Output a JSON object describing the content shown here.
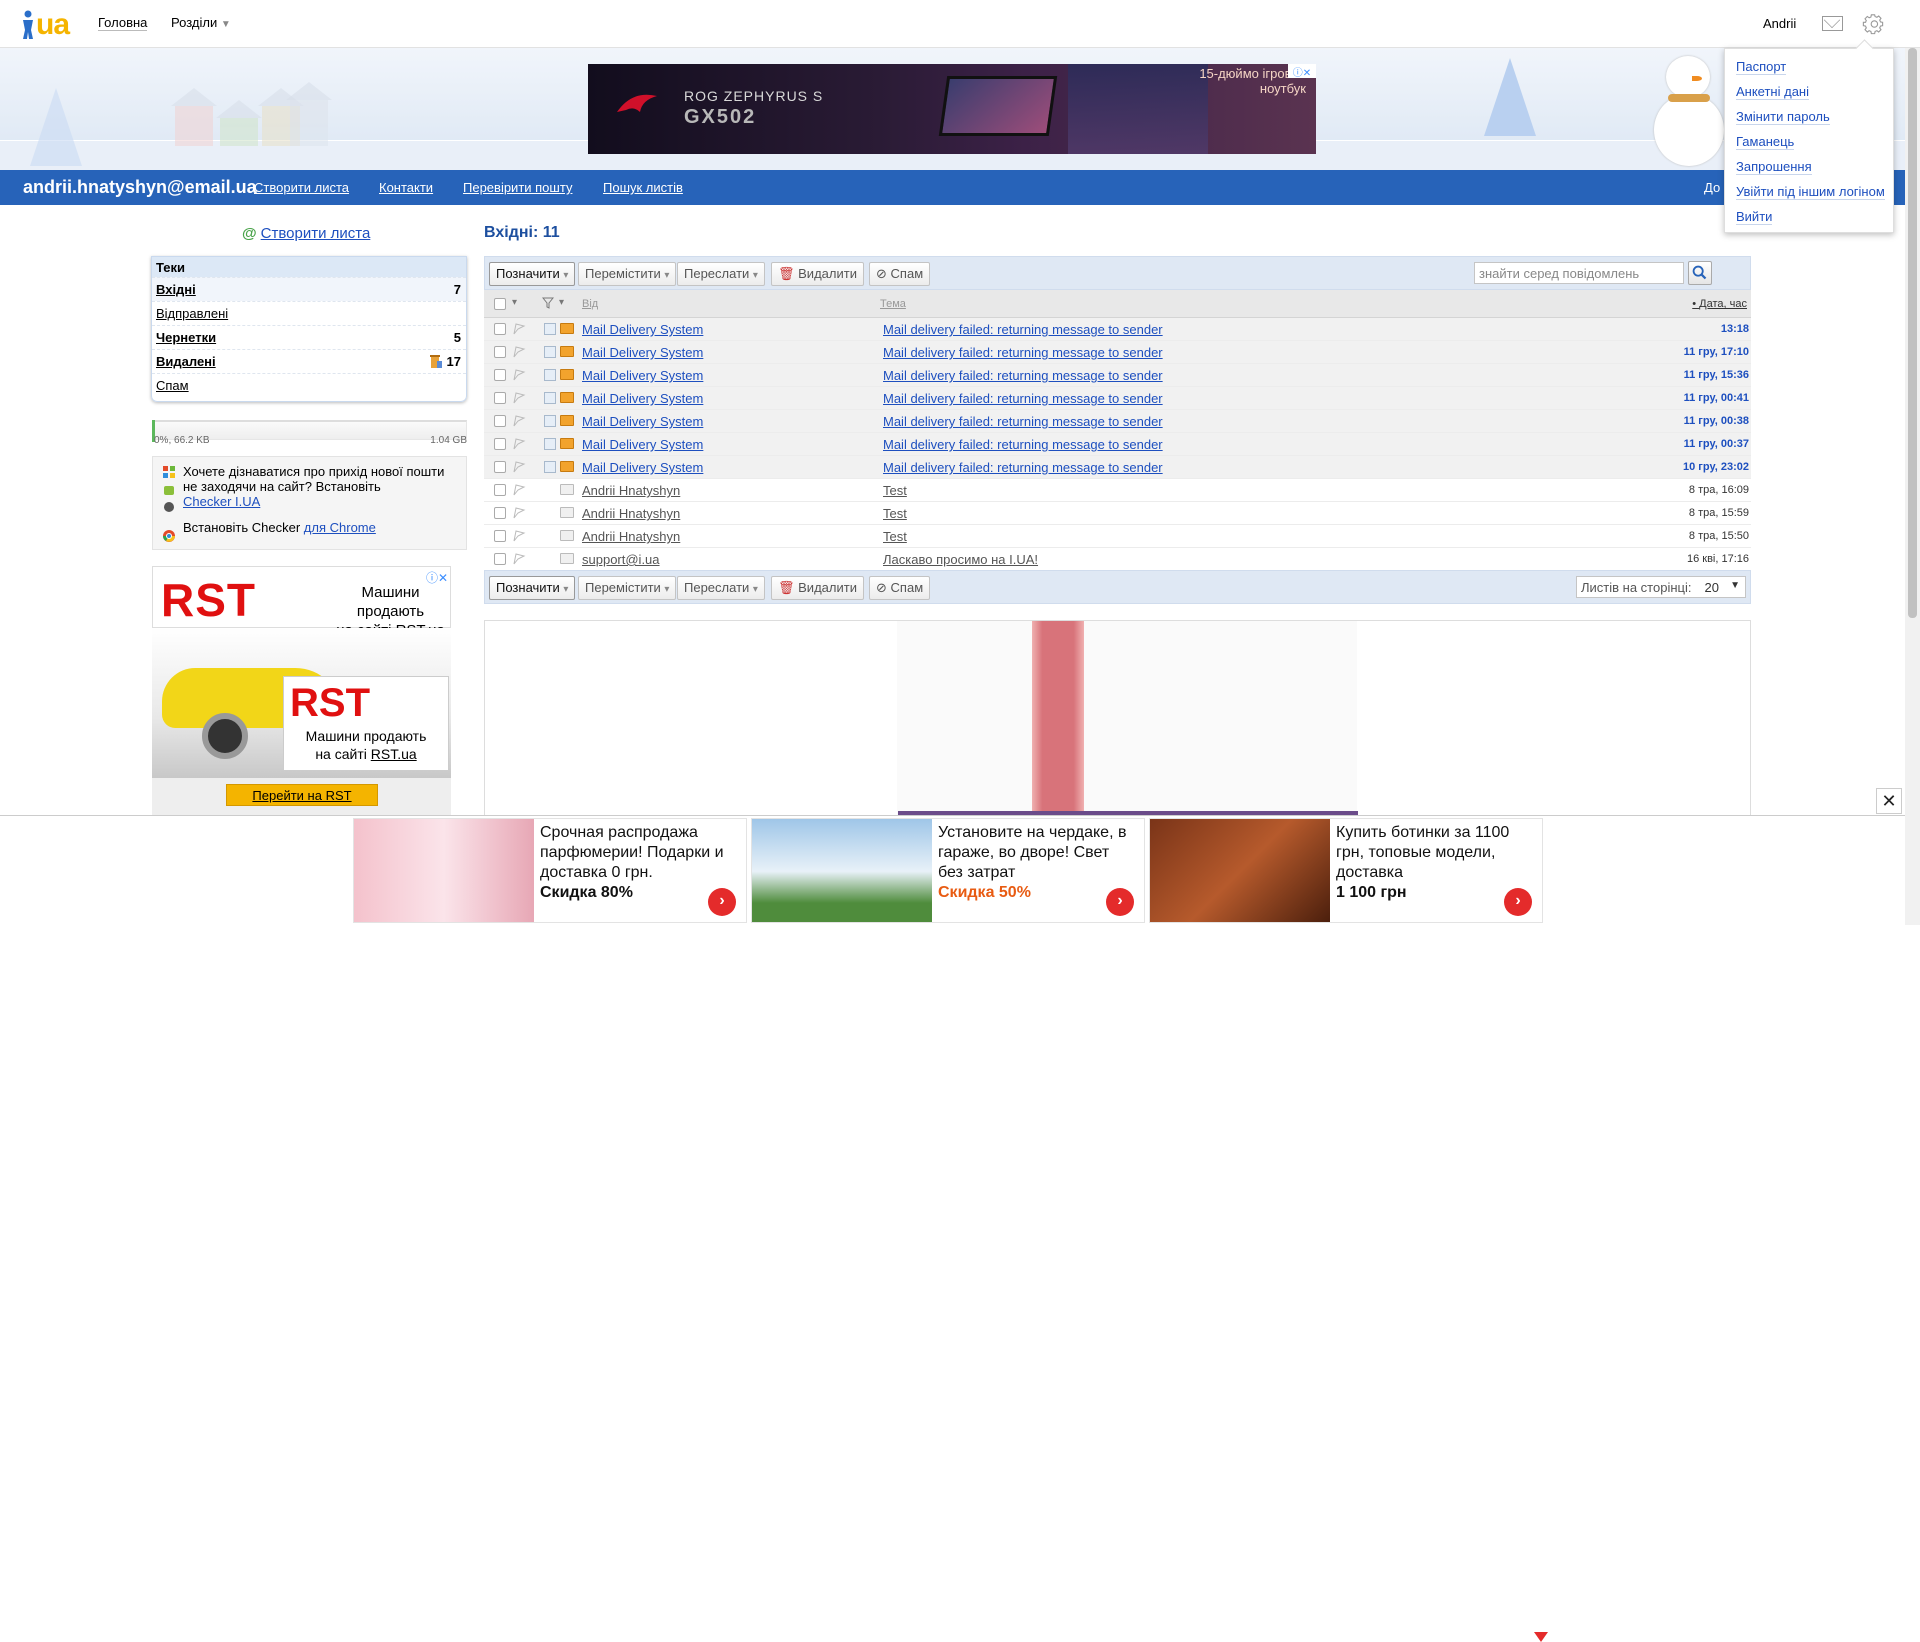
{
  "topbar": {
    "logo_text": "ua",
    "nav": {
      "home": "Головна",
      "sections": "Розділи"
    },
    "user": "Andrii"
  },
  "ad_top": {
    "title1": "ROG ZEPHYRUS S",
    "title2": "GX502",
    "text": "15-дюймо ігровий ноутбук"
  },
  "bluebar": {
    "account": "andrii.hnatyshyn@email.ua",
    "nav": [
      "Створити листа",
      "Контакти",
      "Перевірити пошту",
      "Пошук листів"
    ],
    "more": "До"
  },
  "sidebar": {
    "compose": "Створити листа",
    "folders_header": "Теки",
    "folders": [
      {
        "label": "Вхідні",
        "count": "7",
        "bold": true
      },
      {
        "label": "Відправлені",
        "count": "",
        "bold": false
      },
      {
        "label": "Чернетки",
        "count": "5",
        "bold": true
      },
      {
        "label": "Видалені",
        "count": "17",
        "bold": true
      },
      {
        "label": "Спам",
        "count": "",
        "bold": false
      }
    ],
    "quota_used": "0%, 66.2 KB",
    "quota_total": "1.04 GB",
    "quota_fraction": 0.0,
    "checker_text": "Хочете дізнаватися про прихід нової пошти не заходячи на сайт? Встановіть",
    "checker_link": "Checker I.UA",
    "chrome_text": "Встановіть Checker",
    "chrome_link": "для Chrome"
  },
  "ad_left": {
    "brand": "RST",
    "brand_small": ".ua",
    "line1": "Машини продають",
    "line2": "на сайті",
    "site": "RST.ua",
    "button": "Перейти на RST"
  },
  "main": {
    "title": "Вхідні: 11",
    "toolbar": {
      "mark": "Позначити",
      "move": "Перемістити",
      "forward": "Переслати",
      "delete": "Видалити",
      "spam": "Спам",
      "search_placeholder": "знайти серед повідомлень",
      "per_page_label": "Листів на сторінці:",
      "per_page_value": "20"
    },
    "columns": {
      "from": "Від",
      "subject": "Тема",
      "date": "Дата, час"
    },
    "messages": [
      {
        "from": "Mail Delivery System",
        "subject": "Mail delivery failed: returning message to sender",
        "date": "13:18",
        "unread": true
      },
      {
        "from": "Mail Delivery System",
        "subject": "Mail delivery failed: returning message to sender",
        "date": "11 гру, 17:10",
        "unread": true
      },
      {
        "from": "Mail Delivery System",
        "subject": "Mail delivery failed: returning message to sender",
        "date": "11 гру, 15:36",
        "unread": true
      },
      {
        "from": "Mail Delivery System",
        "subject": "Mail delivery failed: returning message to sender",
        "date": "11 гру, 00:41",
        "unread": true
      },
      {
        "from": "Mail Delivery System",
        "subject": "Mail delivery failed: returning message to sender",
        "date": "11 гру, 00:38",
        "unread": true
      },
      {
        "from": "Mail Delivery System",
        "subject": "Mail delivery failed: returning message to sender",
        "date": "11 гру, 00:37",
        "unread": true
      },
      {
        "from": "Mail Delivery System",
        "subject": "Mail delivery failed: returning message to sender",
        "date": "10 гру, 23:02",
        "unread": true
      },
      {
        "from": "Andrii Hnatyshyn",
        "subject": "Test",
        "date": "8 тра, 16:09",
        "unread": false
      },
      {
        "from": "Andrii Hnatyshyn",
        "subject": "Test",
        "date": "8 тра, 15:59",
        "unread": false
      },
      {
        "from": "Andrii Hnatyshyn",
        "subject": "Test",
        "date": "8 тра, 15:50",
        "unread": false
      },
      {
        "from": "support@i.ua",
        "subject": "Ласкаво просимо на I.UA!",
        "date": "16 кві, 17:16",
        "unread": false
      }
    ]
  },
  "dropdown": {
    "items": [
      "Паспорт",
      "Анкетні дані",
      "Змінити пароль",
      "Гаманець",
      "Запрошення",
      "Увійти під іншим логіном",
      "Вийти"
    ]
  },
  "bottom_ads": [
    {
      "text": "Срочная распродажа парфюмерии! Подарки и доставка 0 грн.",
      "discount": "Скидка 80%"
    },
    {
      "text": "Установите на чердаке, в гараже, во дворе! Свет без затрат",
      "discount": "Скидка 50%"
    },
    {
      "text": "Купить ботинки за 1100 грн, топовые модели, доставка",
      "discount": "1 100 грн"
    }
  ],
  "icons": {
    "gear": "gear-icon",
    "mail": "mail-icon",
    "search": "search-icon",
    "close": "close-icon"
  },
  "colors": {
    "brand_blue": "#2763b9",
    "logo_yellow": "#f5b400",
    "link": "#1d4fbf",
    "ad_red": "#e01010"
  }
}
